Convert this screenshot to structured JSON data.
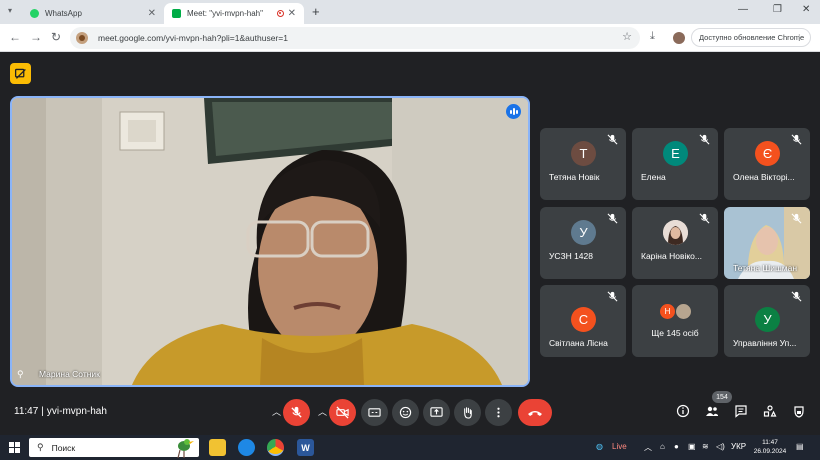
{
  "browser": {
    "tabs": [
      {
        "title": "WhatsApp",
        "favicon_color": "#25d366"
      },
      {
        "title": "Meet: \"yvi-mvpn-hah\"",
        "favicon_color": "#00ac47"
      }
    ],
    "url": "meet.google.com/yvi-mvpn-hah?pli=1&authuser=1",
    "update_label": "Доступно обновление Chrome"
  },
  "meet": {
    "main_speaker": {
      "name": "Марина Сотник"
    },
    "participants": [
      {
        "name": "Тетяна Новік",
        "initial": "Т",
        "color": "#6d4c41"
      },
      {
        "name": "Елена",
        "initial": "Е",
        "color": "#00897b"
      },
      {
        "name": "Олена Вікторі...",
        "initial": "Є",
        "color": "#f4511e"
      },
      {
        "name": "УСЗН 1428",
        "initial": "У",
        "color": "#5f7a8f"
      },
      {
        "name": "Каріна Новіко...",
        "initial": "",
        "color": "#d7ccc8"
      },
      {
        "name": "Тетяна Шишман",
        "initial": "",
        "color": "#9fb9cc"
      },
      {
        "name": "Світлана Лісна",
        "initial": "С",
        "color": "#f4511e"
      },
      {
        "name": "Ще 145 осіб",
        "initial": "Н",
        "color": "#f4511e"
      },
      {
        "name": "Управління Уп...",
        "initial": "У",
        "color": "#0b8043"
      }
    ],
    "time": "11:47",
    "meeting_code": "yvi-mvpn-hah",
    "people_count": "154"
  },
  "taskbar": {
    "search_placeholder": "Поиск",
    "weather": "Live",
    "language": "УКР",
    "clock_time": "11:47",
    "clock_date": "26.09.2024"
  }
}
